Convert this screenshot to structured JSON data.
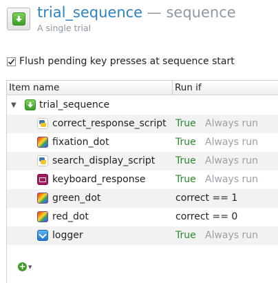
{
  "header": {
    "item_name": "trial_sequence",
    "separator": "—",
    "item_type": "sequence",
    "description": "A single trial",
    "icon": "sequence-arrow-icon"
  },
  "options": {
    "flush_label": "Flush pending key presses at sequence start",
    "flush_checked": true
  },
  "tree": {
    "columns": [
      "Item name",
      "Run if"
    ],
    "root": {
      "name": "trial_sequence",
      "icon": "sequence-icon",
      "expanded": true
    },
    "items": [
      {
        "name": "correct_response_script",
        "icon": "python-icon",
        "condition": "True",
        "always": "Always run"
      },
      {
        "name": "fixation_dot",
        "icon": "sketchpad-icon",
        "condition": "True",
        "always": "Always run"
      },
      {
        "name": "search_display_script",
        "icon": "python-icon",
        "condition": "True",
        "always": "Always run"
      },
      {
        "name": "keyboard_response",
        "icon": "keyboard-icon",
        "condition": "True",
        "always": "Always run"
      },
      {
        "name": "green_dot",
        "icon": "sketchpad-icon",
        "condition": "correct == 1",
        "always": ""
      },
      {
        "name": "red_dot",
        "icon": "sketchpad-icon",
        "condition": "correct == 0",
        "always": ""
      },
      {
        "name": "logger",
        "icon": "logger-icon",
        "condition": "True",
        "always": "Always run"
      }
    ]
  },
  "footer": {
    "add_icon": "add-item-icon"
  },
  "colors": {
    "title": "#2e82c2",
    "true_condition": "#2a8a2a",
    "always_run": "#9aa0a6"
  }
}
